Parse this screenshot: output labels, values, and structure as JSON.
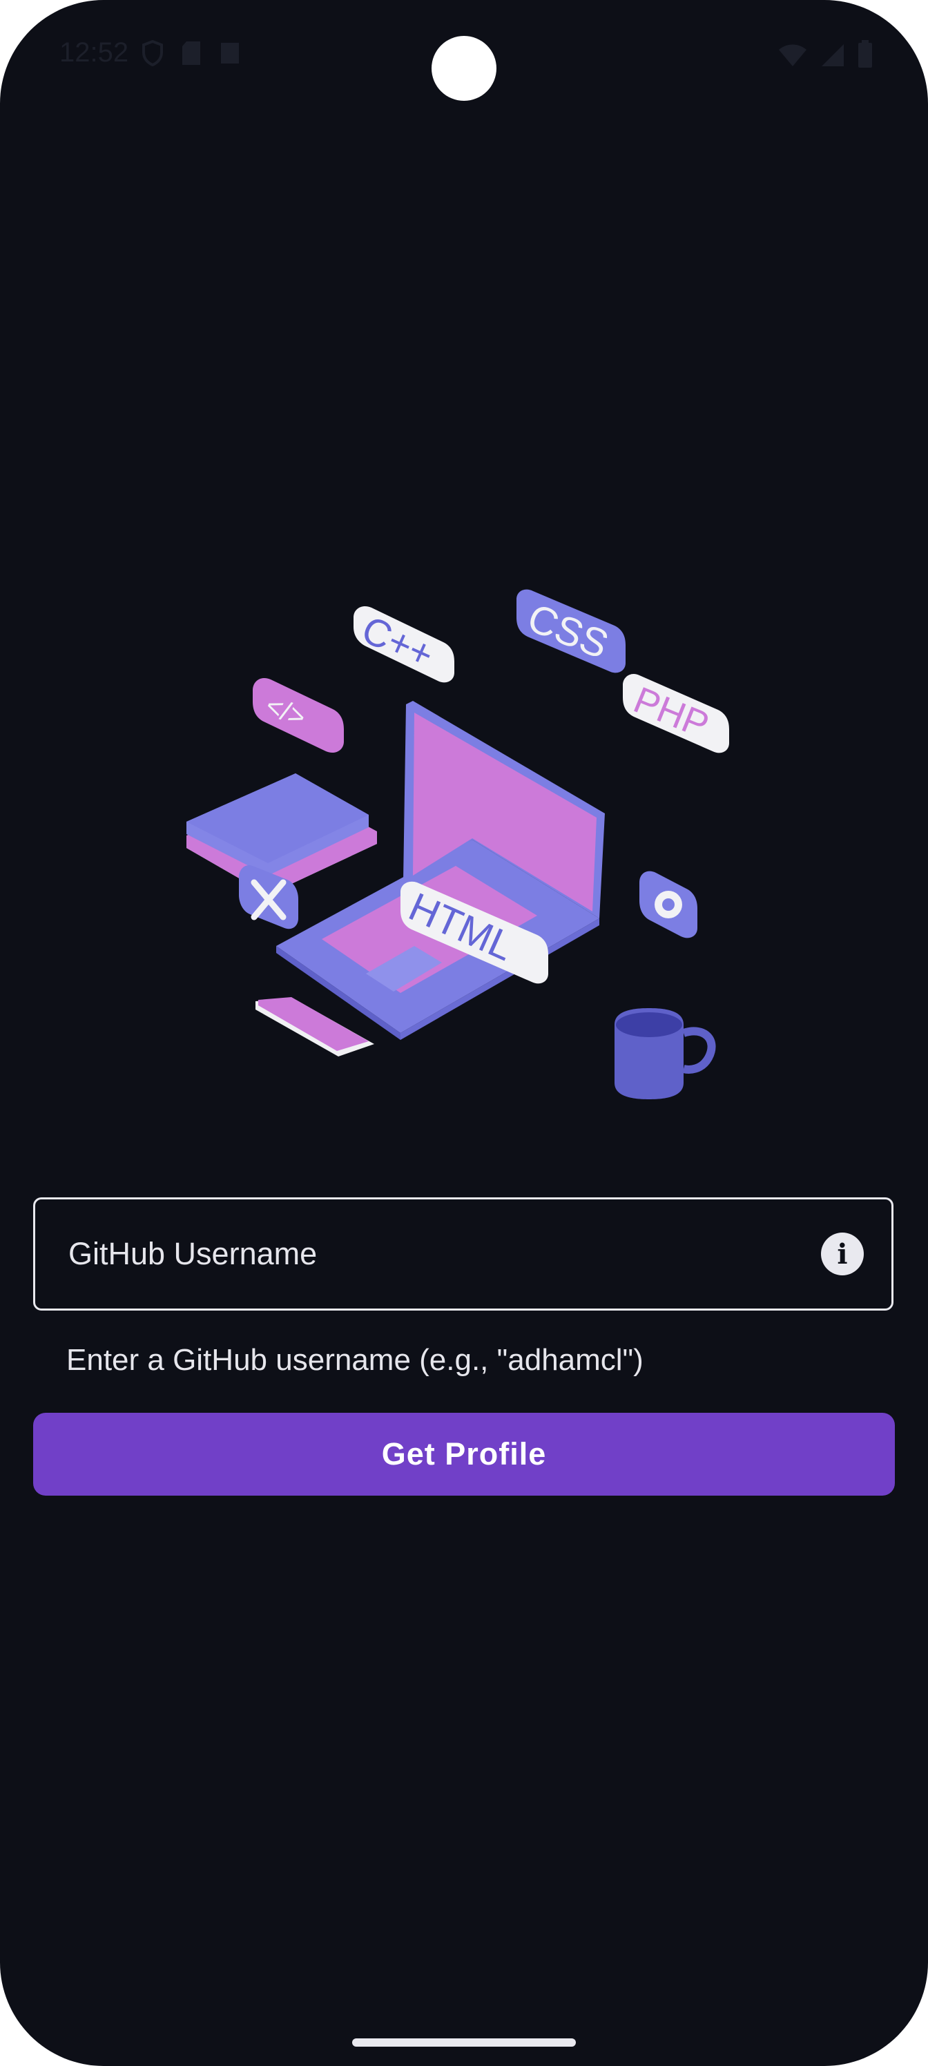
{
  "status_bar": {
    "time": "12:52",
    "left_icons": [
      "shield-icon",
      "sd-card-icon",
      "accessibility-icon"
    ],
    "right_icons": [
      "wifi-icon",
      "signal-icon",
      "battery-icon"
    ]
  },
  "illustration": {
    "badges": {
      "cpp": "C++",
      "css": "CSS",
      "php": "PHP",
      "code": "</>",
      "html": "HTML"
    },
    "colors": {
      "purple": "#7c7ee3",
      "pink": "#cc7ad9",
      "light": "#e9e9ee"
    }
  },
  "form": {
    "username_placeholder": "GitHub Username",
    "username_value": "",
    "helper": "Enter a GitHub username (e.g., \"adhamcl\")",
    "submit_label": "Get Profile"
  },
  "theme": {
    "background": "#0d0f17",
    "accent": "#7140c8"
  }
}
